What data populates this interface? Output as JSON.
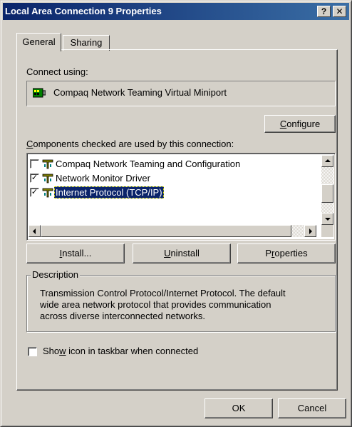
{
  "window": {
    "title": "Local Area Connection 9 Properties",
    "help_label": "?",
    "close_label": "✕"
  },
  "tabs": [
    {
      "label": "General",
      "selected": true
    },
    {
      "label": "Sharing",
      "selected": false
    }
  ],
  "general": {
    "connect_using_label": "Connect using:",
    "adapter_name": "Compaq Network Teaming Virtual Miniport",
    "configure_button": {
      "pre": "",
      "key": "C",
      "post": "onfigure"
    },
    "components_label": {
      "pre": "",
      "key": "C",
      "post": "omponents checked are used by this connection:"
    },
    "components": [
      {
        "label": "Compaq Network Teaming and Configuration",
        "checked": false,
        "selected": false
      },
      {
        "label": "Network Monitor Driver",
        "checked": true,
        "selected": false
      },
      {
        "label": "Internet Protocol (TCP/IP)",
        "checked": true,
        "selected": true
      }
    ],
    "install_button": {
      "pre": "",
      "key": "I",
      "post": "nstall..."
    },
    "uninstall_button": {
      "pre": "",
      "key": "U",
      "post": "ninstall"
    },
    "properties_button": {
      "pre": "P",
      "key": "r",
      "post": "operties"
    },
    "description_legend": "Description",
    "description_lines": [
      "Transmission Control Protocol/Internet Protocol. The default",
      "wide area network protocol that provides communication",
      "across diverse interconnected networks."
    ],
    "show_icon_checkbox": {
      "pre": "Sho",
      "key": "w",
      "post": " icon in taskbar when connected",
      "checked": false
    }
  },
  "footer": {
    "ok_label": "OK",
    "cancel_label": "Cancel"
  },
  "colors": {
    "face": "#d4d0c8",
    "title_start": "#0a246a",
    "title_end": "#3a6ea5",
    "selection": "#0a246a"
  }
}
